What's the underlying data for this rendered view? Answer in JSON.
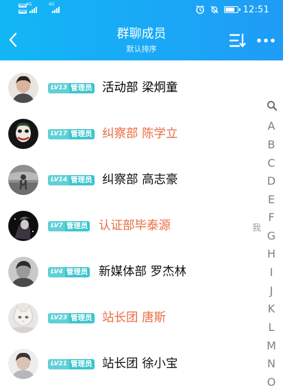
{
  "status_bar": {
    "time": "12:51",
    "left_tags": [
      "HD",
      "HD"
    ],
    "left_signals": [
      "4G",
      "4G"
    ]
  },
  "header": {
    "title": "群聊成员",
    "subtitle": "默认排序",
    "back_icon": "chevron-left-icon",
    "sort_icon": "sort-icon",
    "more_icon": "more-dots-icon",
    "color_start": "#12b7f5",
    "color_end": "#1f9cf6"
  },
  "members": [
    {
      "level": "LV13",
      "role": "管理员",
      "name": "活动部 梁炯童",
      "highlight": false
    },
    {
      "level": "LV17",
      "role": "管理员",
      "name": "纠察部 陈学立",
      "highlight": true
    },
    {
      "level": "LV14",
      "role": "管理员",
      "name": "纠察部 高志豪",
      "highlight": false
    },
    {
      "level": "LV7",
      "role": "管理员",
      "name": "认证部毕泰源",
      "highlight": true
    },
    {
      "level": "LV4",
      "role": "管理员",
      "name": "新媒体部 罗杰林",
      "highlight": false
    },
    {
      "level": "LV23",
      "role": "管理员",
      "name": "站长团 唐斯",
      "highlight": true
    },
    {
      "level": "LV21",
      "role": "管理员",
      "name": "站长团 徐小宝",
      "highlight": false
    }
  ],
  "index_bar": {
    "search_icon": "search-icon",
    "letters": [
      "A",
      "B",
      "C",
      "D",
      "E",
      "F",
      "G",
      "H",
      "I",
      "J",
      "K",
      "L",
      "M",
      "N",
      "O"
    ]
  },
  "me_label": "我",
  "colors": {
    "badge_level": "#5fd0d6",
    "badge_role": "#3cc5ce",
    "name_highlight": "#ea6d43",
    "name_default": "#111111"
  }
}
